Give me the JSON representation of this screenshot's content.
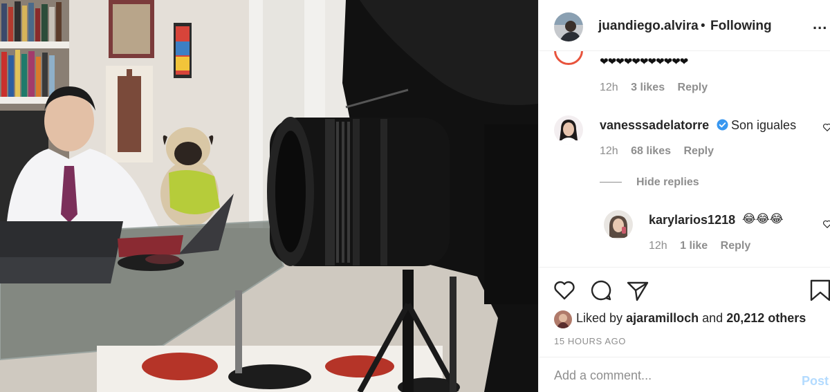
{
  "header": {
    "username": "juandiego.alvira",
    "separator": "•",
    "follow_status": "Following",
    "more_icon": "more-horizontal-icon",
    "more_label": "..."
  },
  "comments": [
    {
      "text": "❤❤❤❤❤❤❤❤❤❤❤",
      "time": "12h",
      "likes": "3 likes",
      "reply": "Reply"
    },
    {
      "username": "vanesssadelatorre",
      "verified": true,
      "text": "Son iguales",
      "time": "12h",
      "likes": "68 likes",
      "reply": "Reply"
    }
  ],
  "hide_replies": "Hide replies",
  "replies": [
    {
      "username": "karylarios1218",
      "text": "😂😂😂",
      "time": "12h",
      "likes": "1 like",
      "reply": "Reply"
    }
  ],
  "actions": {
    "like_icon": "heart-icon",
    "comment_icon": "comment-icon",
    "share_icon": "share-icon",
    "save_icon": "bookmark-icon"
  },
  "likes": {
    "prefix": "Liked by",
    "user": "ajaramilloch",
    "middle": "and",
    "others": "20,212 others"
  },
  "time_ago": "15 HOURS AGO",
  "add_comment": {
    "placeholder": "Add a comment...",
    "post_label": "Post"
  },
  "colors": {
    "text": "#262626",
    "secondary": "#8e8e8e",
    "verified_blue": "#3897f0",
    "post_disabled": "#b3dbff",
    "divider": "#efefef"
  }
}
